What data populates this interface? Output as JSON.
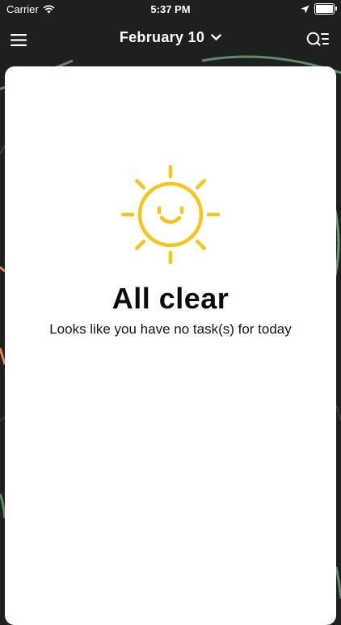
{
  "status_bar": {
    "carrier": "Carrier",
    "time": "5:37 PM",
    "icons": [
      "wifi-icon",
      "location-arrow-icon",
      "battery-icon"
    ],
    "battery_level": 1.0
  },
  "nav": {
    "menu_icon": "hamburger-menu-icon",
    "date_label": "February 10",
    "chevron_icon": "chevron-down-icon",
    "action_icon": "search-list-icon"
  },
  "empty_state": {
    "icon": "smiling-sun-icon",
    "title": "All clear",
    "message": "Looks like you have no task(s) for today"
  },
  "colors": {
    "background": "#1e1f1f",
    "card": "#ffffff",
    "accent_sun": "#f5c518",
    "map_route_green": "#7fb88a",
    "map_route_orange": "#e0895a"
  }
}
